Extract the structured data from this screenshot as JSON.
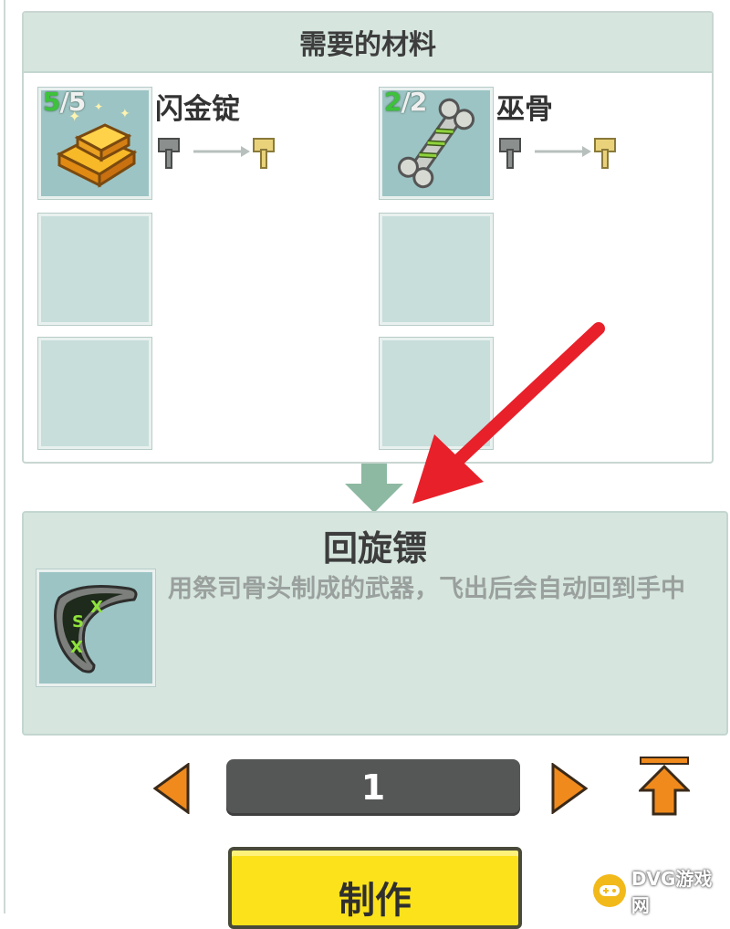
{
  "materials_panel": {
    "title": "需要的材料",
    "materials": [
      {
        "name": "闪金锭",
        "have": "5",
        "need": "/5",
        "icon": "gold-ingot-icon"
      },
      {
        "name": "巫骨",
        "have": "2",
        "need": "/2",
        "icon": "witch-bone-icon"
      }
    ]
  },
  "result": {
    "name": "回旋镖",
    "description": "用祭司骨头制成的武器，飞出后会自动回到手中",
    "icon": "boomerang-icon"
  },
  "quantity": {
    "value": "1"
  },
  "craft_button": {
    "label": "制作"
  },
  "watermark": {
    "text": "DVG游戏网"
  },
  "colors": {
    "panel_header": "#d6e6df",
    "slot_filled": "#9cc4c4",
    "slot_empty": "#c7dedb",
    "count_have": "#3ec23c",
    "arrow_orange": "#f08a1c",
    "craft_yellow": "#fbe21a",
    "annotation_red": "#e8202a"
  }
}
